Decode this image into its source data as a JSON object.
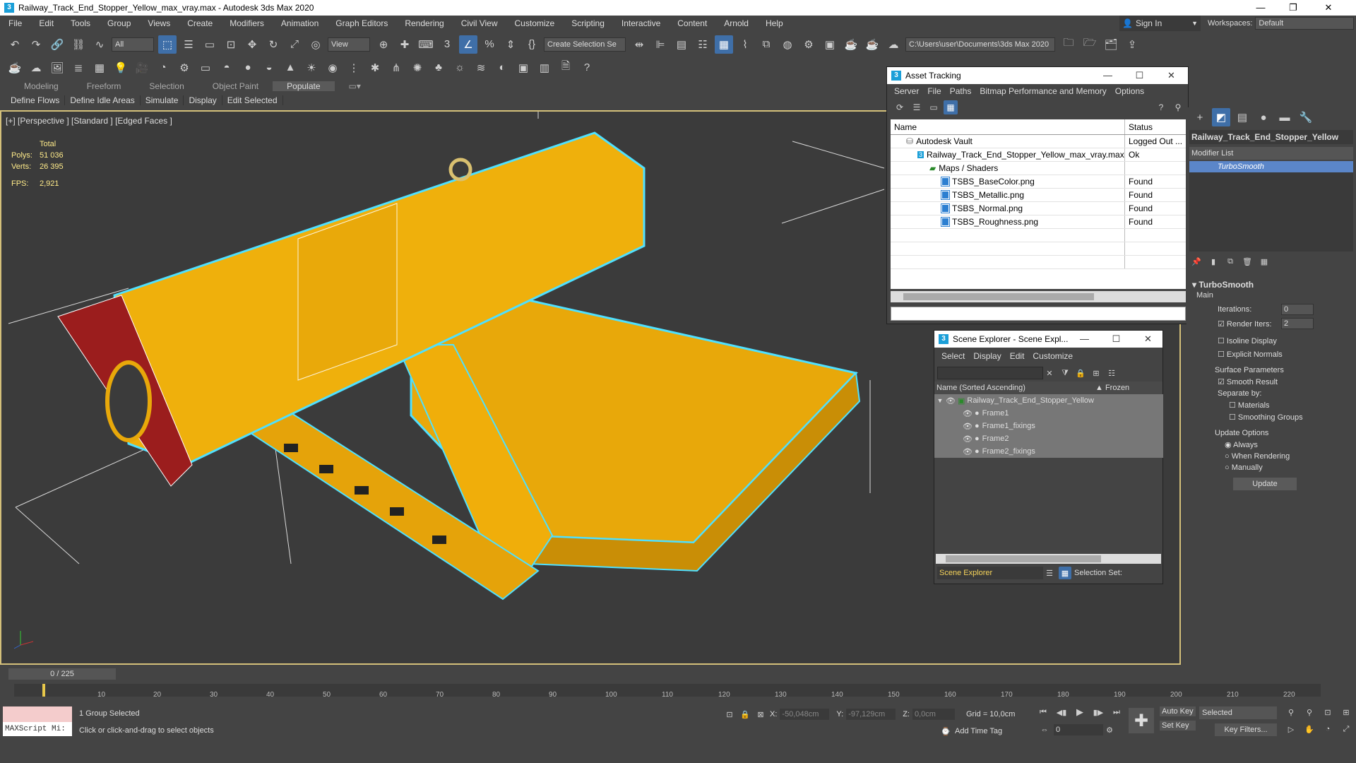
{
  "titlebar": {
    "icon": "3",
    "title": "Railway_Track_End_Stopper_Yellow_max_vray.max - Autodesk 3ds Max 2020",
    "min": "—",
    "max": "❐",
    "close": "✕"
  },
  "menu": [
    "File",
    "Edit",
    "Tools",
    "Group",
    "Views",
    "Create",
    "Modifiers",
    "Animation",
    "Graph Editors",
    "Rendering",
    "Civil View",
    "Customize",
    "Scripting",
    "Interactive",
    "Content",
    "Arnold",
    "Help"
  ],
  "account": {
    "signin": "Sign In",
    "workspaces_label": "Workspaces:",
    "workspace": "Default"
  },
  "toolbar1": {
    "filter": "All",
    "refcoord": "View",
    "selection_set": "Create Selection Se",
    "path": "C:\\Users\\user\\Documents\\3ds Max 2020"
  },
  "ribbon": {
    "tabs": [
      "Modeling",
      "Freeform",
      "Selection",
      "Object Paint",
      "Populate"
    ],
    "active": "Populate",
    "subtabs": [
      "Define Flows",
      "Define Idle Areas",
      "Simulate",
      "Display",
      "Edit Selected"
    ]
  },
  "viewport": {
    "label": "[+] [Perspective ] [Standard ] [Edged Faces ]",
    "stats_header": "Total",
    "polys_label": "Polys:",
    "polys": "51 036",
    "verts_label": "Verts:",
    "verts": "26 395",
    "fps_label": "FPS:",
    "fps": "2,921"
  },
  "asset_tracking": {
    "title": "Asset Tracking",
    "menu": [
      "Server",
      "File",
      "Paths",
      "Bitmap Performance and Memory",
      "Options"
    ],
    "col_name": "Name",
    "col_status": "Status",
    "rows": [
      {
        "name": "Autodesk Vault",
        "status": "Logged Out ...",
        "indent": 0,
        "icon": "vault"
      },
      {
        "name": "Railway_Track_End_Stopper_Yellow_max_vray.max",
        "status": "Ok",
        "indent": 1,
        "icon": "max"
      },
      {
        "name": "Maps / Shaders",
        "status": "",
        "indent": 2,
        "icon": "folder"
      },
      {
        "name": "TSBS_BaseColor.png",
        "status": "Found",
        "indent": 3,
        "icon": "file"
      },
      {
        "name": "TSBS_Metallic.png",
        "status": "Found",
        "indent": 3,
        "icon": "file"
      },
      {
        "name": "TSBS_Normal.png",
        "status": "Found",
        "indent": 3,
        "icon": "file"
      },
      {
        "name": "TSBS_Roughness.png",
        "status": "Found",
        "indent": 3,
        "icon": "file"
      }
    ]
  },
  "scene_explorer": {
    "title": "Scene Explorer - Scene Expl...",
    "menu": [
      "Select",
      "Display",
      "Edit",
      "Customize"
    ],
    "col_name": "Name (Sorted Ascending)",
    "col_frozen": "▲ Frozen",
    "root": "Railway_Track_End_Stopper_Yellow",
    "children": [
      "Frame1",
      "Frame1_fixings",
      "Frame2",
      "Frame2_fixings"
    ],
    "footer_select": "Scene Explorer",
    "footer_label": "Selection Set:"
  },
  "command_panel": {
    "object_name": "Railway_Track_End_Stopper_Yellow",
    "modifier_list": "Modifier List",
    "modifier": "TurboSmooth",
    "rollout": "TurboSmooth",
    "main": "Main",
    "iterations_label": "Iterations:",
    "iterations": "0",
    "render_iters_label": "Render Iters:",
    "render_iters": "2",
    "isoline": "Isoline Display",
    "explicit_normals": "Explicit Normals",
    "surface_params": "Surface Parameters",
    "smooth_result": "Smooth Result",
    "separate_by": "Separate by:",
    "materials": "Materials",
    "smoothing_groups": "Smoothing Groups",
    "update_options": "Update Options",
    "always": "Always",
    "when_rendering": "When Rendering",
    "manually": "Manually",
    "update": "Update"
  },
  "timeline": {
    "frame": "0 / 225",
    "ticks": [
      "10",
      "20",
      "30",
      "40",
      "50",
      "60",
      "70",
      "80",
      "90",
      "100",
      "110",
      "120",
      "130",
      "140",
      "150",
      "160",
      "170",
      "180",
      "190",
      "200",
      "210",
      "220"
    ]
  },
  "status": {
    "maxscript": "MAXScript Mi:",
    "selected": "1 Group Selected",
    "prompt": "Click or click-and-drag to select objects",
    "x_label": "X:",
    "x": "-50,048cm",
    "y_label": "Y:",
    "y": "-97,129cm",
    "z_label": "Z:",
    "z": "0,0cm",
    "grid": "Grid = 10,0cm",
    "add_time_tag": "Add Time Tag",
    "auto_key": "Auto Key",
    "set_key": "Set Key",
    "key_mode": "Selected",
    "key_filters": "Key Filters...",
    "frame_field": "0"
  }
}
